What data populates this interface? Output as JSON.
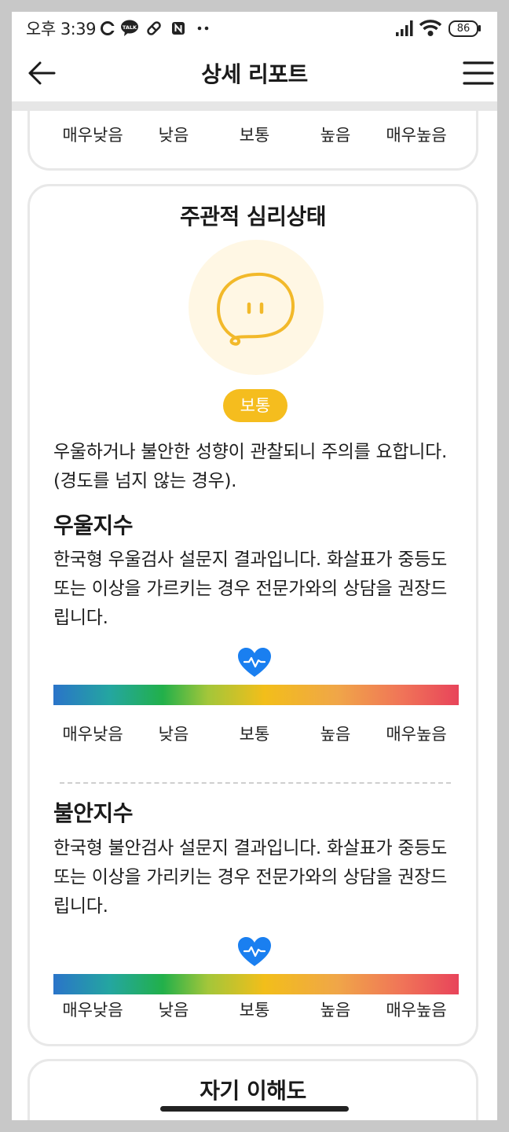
{
  "status_bar": {
    "time": "오후 3:39",
    "battery": "86",
    "icons": [
      "c-icon",
      "kakaotalk-icon",
      "pill-icon",
      "notification-n-icon",
      "more-dots-icon",
      "signal-icon",
      "wifi-icon",
      "battery-icon"
    ]
  },
  "header": {
    "title": "상세 리포트",
    "back_icon": "arrow-left-icon",
    "menu_icon": "hamburger-menu-icon"
  },
  "scale_labels": [
    "매우낮음",
    "낮음",
    "보통",
    "높음",
    "매우높음"
  ],
  "mental_card": {
    "title": "주관적 심리상태",
    "face_icon": "neutral-face-icon",
    "badge": "보통",
    "description": "우울하거나 불안한 성향이 관찰되니 주의를 요합니다. (경도를 넘지 않는 경우).",
    "depression": {
      "title": "우울지수",
      "description": "한국형 우울검사 설문지 결과입니다. 화살표가 중등도 또는 이상을 가르키는 경우 전문가와의 상담을 권장드립니다.",
      "level": "보통"
    },
    "anxiety": {
      "title": "불안지수",
      "description": "한국형 불안검사 설문지 결과입니다. 화살표가 중등도 또는 이상을 가리키는 경우 전문가와의 상담을 권장드립니다.",
      "level": "보통"
    }
  },
  "next_card": {
    "title": "자기 이해도"
  },
  "colors": {
    "accent": "#f5bd1e",
    "heart": "#1a7ff0",
    "face_bg": "#fff7e4",
    "card_border": "#e8e8e8"
  }
}
